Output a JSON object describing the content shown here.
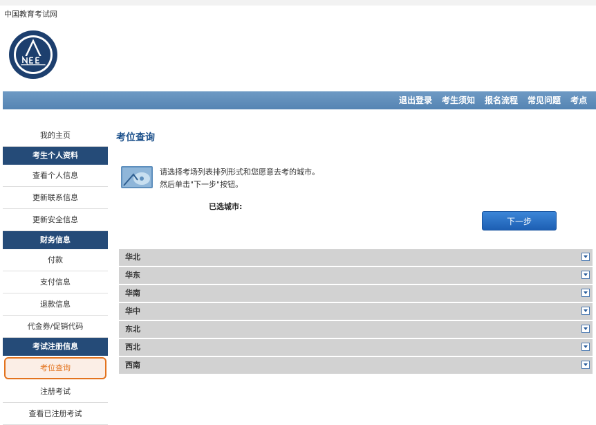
{
  "header": {
    "site_name": "中国教育考试网"
  },
  "nav": {
    "items": [
      "退出登录",
      "考生须知",
      "报名流程",
      "常见问题",
      "考点"
    ]
  },
  "sidebar": {
    "home": "我的主页",
    "section1": {
      "title": "考生个人资料",
      "items": [
        "查看个人信息",
        "更新联系信息",
        "更新安全信息"
      ]
    },
    "section2": {
      "title": "财务信息",
      "items": [
        "付款",
        "支付信息",
        "退款信息",
        "代金券/促销代码"
      ]
    },
    "section3": {
      "title": "考试注册信息",
      "items": [
        "考位查询",
        "注册考试",
        "查看已注册考试"
      ]
    }
  },
  "main": {
    "title": "考位查询",
    "instruction_line1": "请选择考场列表排列形式和您愿意去考的城市。",
    "instruction_line2": "然后单击\"下一步\"按钮。",
    "selected_cities_label": "已选城市:",
    "next_button": "下一步",
    "regions": [
      "华北",
      "华东",
      "华南",
      "华中",
      "东北",
      "西北",
      "西南"
    ]
  },
  "colors": {
    "nav_bg": "#5f8fbd",
    "side_header_bg": "#254b78",
    "active_accent": "#e3731e"
  }
}
